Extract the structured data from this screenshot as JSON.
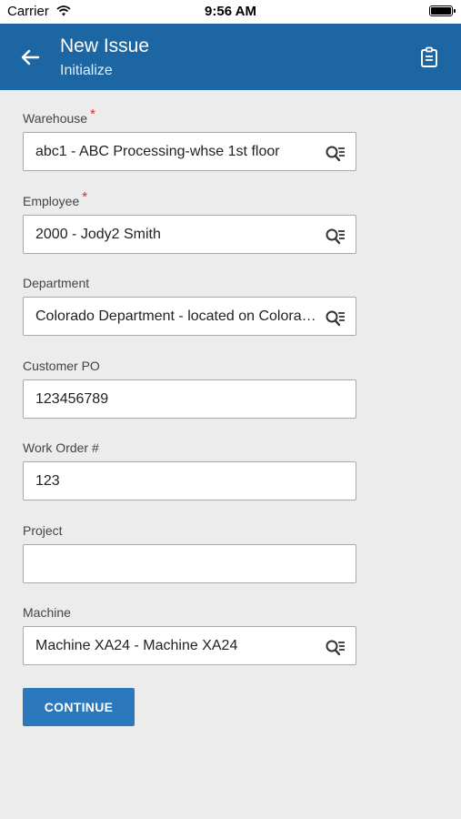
{
  "status_bar": {
    "carrier": "Carrier",
    "time": "9:56 AM"
  },
  "header": {
    "title": "New Issue",
    "subtitle": "Initialize",
    "back_icon": "arrow-left-icon",
    "action_icon": "clipboard-icon"
  },
  "form": {
    "warehouse": {
      "label": "Warehouse",
      "required_mark": "*",
      "value": "abc1 - ABC Processing-whse 1st floor"
    },
    "employee": {
      "label": "Employee",
      "required_mark": "*",
      "value": "2000 - Jody2 Smith"
    },
    "department": {
      "label": "Department",
      "value": "Colorado Department - located on Colorado Ave"
    },
    "customer_po": {
      "label": "Customer PO",
      "value": "123456789"
    },
    "work_order": {
      "label": "Work Order #",
      "value": "123"
    },
    "project": {
      "label": "Project",
      "value": ""
    },
    "machine": {
      "label": "Machine",
      "value": "Machine XA24 - Machine XA24"
    }
  },
  "actions": {
    "continue_label": "CONTINUE"
  },
  "colors": {
    "app_bar": "#1d66a4",
    "button": "#2b78bd",
    "required": "#d92b2b",
    "background": "#ececec"
  }
}
